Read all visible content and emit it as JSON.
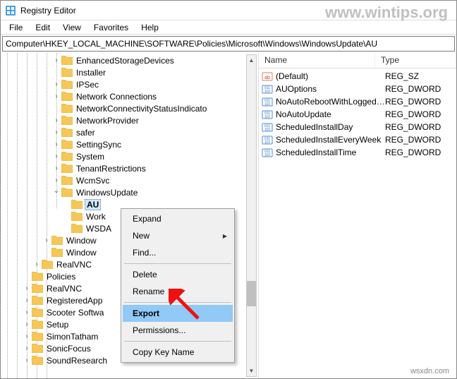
{
  "window": {
    "title": "Registry Editor"
  },
  "watermarks": {
    "top": "www.wintips.org",
    "bottom": "wsxdn.com"
  },
  "menu": {
    "file": "File",
    "edit": "Edit",
    "view": "View",
    "favorites": "Favorites",
    "help": "Help"
  },
  "address": "Computer\\HKEY_LOCAL_MACHINE\\SOFTWARE\\Policies\\Microsoft\\Windows\\WindowsUpdate\\AU",
  "tree": [
    {
      "indent": 5,
      "exp": ">",
      "label": "EnhancedStorageDevices"
    },
    {
      "indent": 5,
      "exp": "",
      "label": "Installer"
    },
    {
      "indent": 5,
      "exp": ">",
      "label": "IPSec"
    },
    {
      "indent": 5,
      "exp": ">",
      "label": "Network Connections"
    },
    {
      "indent": 5,
      "exp": "",
      "label": "NetworkConnectivityStatusIndicato"
    },
    {
      "indent": 5,
      "exp": ">",
      "label": "NetworkProvider"
    },
    {
      "indent": 5,
      "exp": ">",
      "label": "safer"
    },
    {
      "indent": 5,
      "exp": ">",
      "label": "SettingSync"
    },
    {
      "indent": 5,
      "exp": ">",
      "label": "System"
    },
    {
      "indent": 5,
      "exp": ">",
      "label": "TenantRestrictions"
    },
    {
      "indent": 5,
      "exp": ">",
      "label": "WcmSvc"
    },
    {
      "indent": 5,
      "exp": "v",
      "label": "WindowsUpdate"
    },
    {
      "indent": 6,
      "exp": "",
      "label": "AU",
      "selected": true
    },
    {
      "indent": 6,
      "exp": "",
      "label": "Work"
    },
    {
      "indent": 6,
      "exp": "",
      "label": "WSDA"
    },
    {
      "indent": 4,
      "exp": ">",
      "label": "Window"
    },
    {
      "indent": 4,
      "exp": "",
      "label": "Window"
    },
    {
      "indent": 3,
      "exp": ">",
      "label": "RealVNC"
    },
    {
      "indent": 2,
      "exp": "",
      "label": "Policies"
    },
    {
      "indent": 2,
      "exp": ">",
      "label": "RealVNC"
    },
    {
      "indent": 2,
      "exp": ">",
      "label": "RegisteredApp"
    },
    {
      "indent": 2,
      "exp": ">",
      "label": "Scooter Softwa"
    },
    {
      "indent": 2,
      "exp": ">",
      "label": "Setup"
    },
    {
      "indent": 2,
      "exp": ">",
      "label": "SimonTatham"
    },
    {
      "indent": 2,
      "exp": ">",
      "label": "SonicFocus"
    },
    {
      "indent": 2,
      "exp": ">",
      "label": "SoundResearch"
    }
  ],
  "list": {
    "headers": {
      "name": "Name",
      "type": "Type"
    },
    "rows": [
      {
        "icon": "sz",
        "name": "(Default)",
        "type": "REG_SZ"
      },
      {
        "icon": "dw",
        "name": "AUOptions",
        "type": "REG_DWORD"
      },
      {
        "icon": "dw",
        "name": "NoAutoRebootWithLoggedOnU...",
        "type": "REG_DWORD"
      },
      {
        "icon": "dw",
        "name": "NoAutoUpdate",
        "type": "REG_DWORD"
      },
      {
        "icon": "dw",
        "name": "ScheduledInstallDay",
        "type": "REG_DWORD"
      },
      {
        "icon": "dw",
        "name": "ScheduledInstallEveryWeek",
        "type": "REG_DWORD"
      },
      {
        "icon": "dw",
        "name": "ScheduledInstallTime",
        "type": "REG_DWORD"
      }
    ]
  },
  "context_menu": {
    "expand": "Expand",
    "new": "New",
    "find": "Find...",
    "delete": "Delete",
    "rename": "Rename",
    "export": "Export",
    "permissions": "Permissions...",
    "copy": "Copy Key Name"
  }
}
